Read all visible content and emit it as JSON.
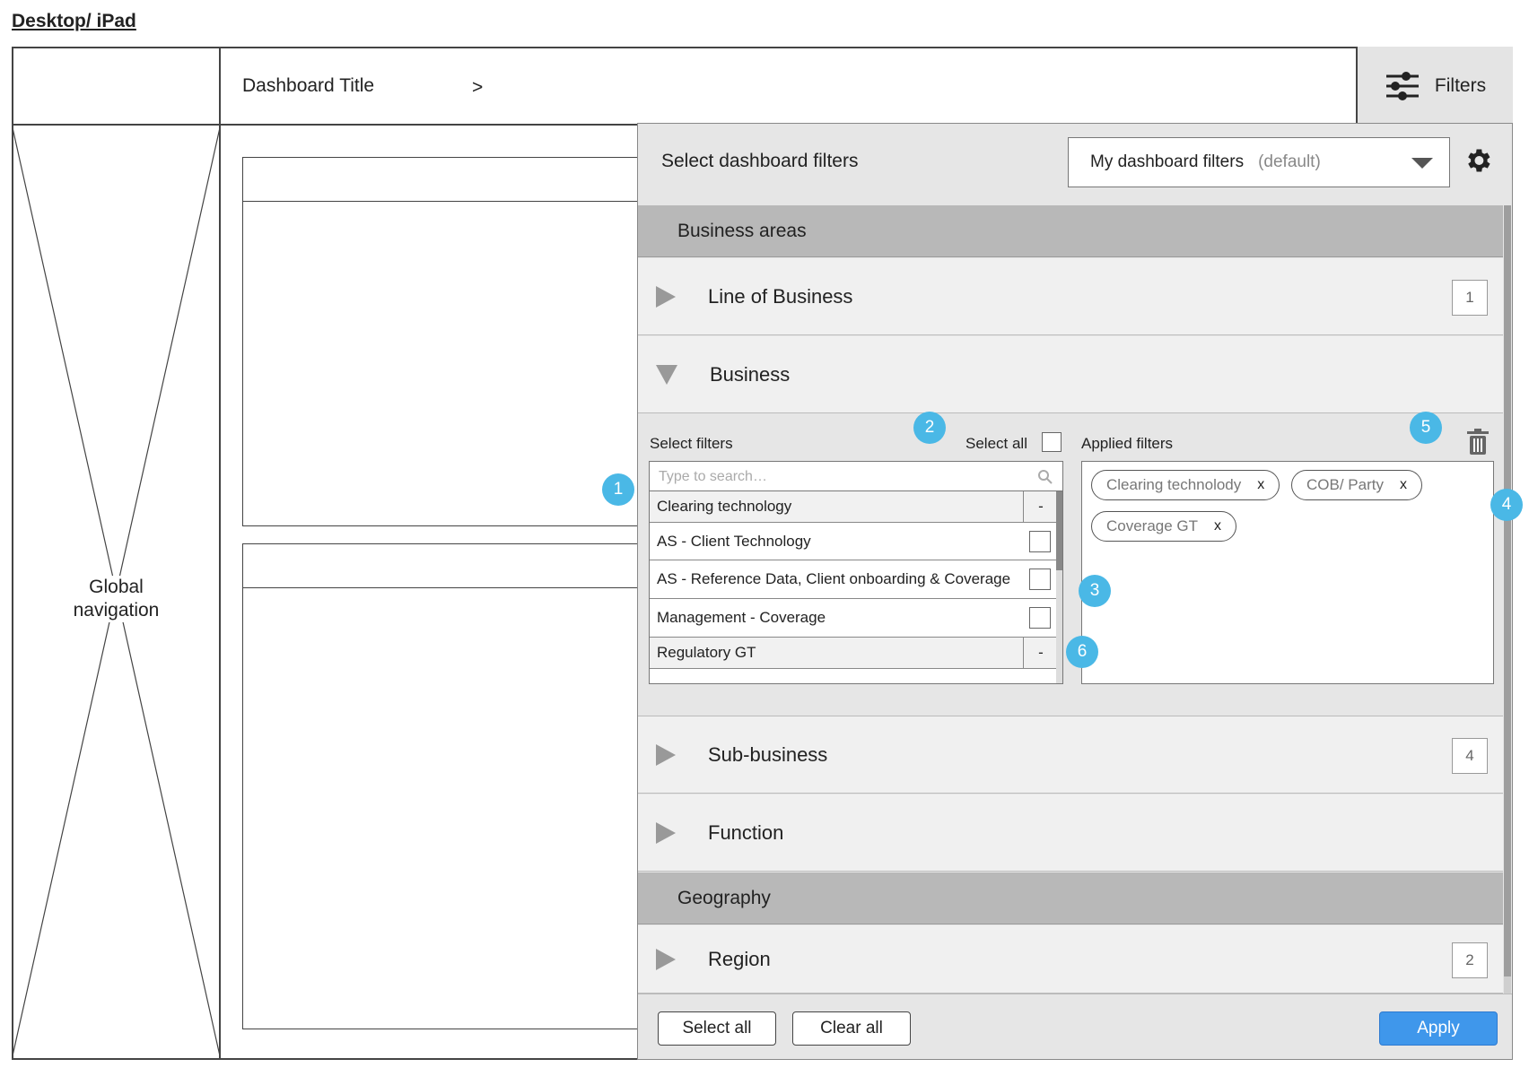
{
  "page_label": "Desktop/ iPad",
  "header": {
    "title": "Dashboard Title",
    "chevron": ">",
    "filters_label": "Filters"
  },
  "nav": {
    "label_line1": "Global",
    "label_line2": "navigation"
  },
  "panel": {
    "title": "Select dashboard filters",
    "preset": {
      "value": "My dashboard filters",
      "note": "(default)"
    },
    "sections": [
      {
        "label": "Business areas"
      },
      {
        "label": "Geography"
      }
    ],
    "rows": [
      {
        "label": "Line of Business",
        "count": "1"
      },
      {
        "label": "Business",
        "count": ""
      },
      {
        "label": "Sub-business",
        "count": "4"
      },
      {
        "label": "Function",
        "count": ""
      },
      {
        "label": "Region",
        "count": "2"
      }
    ],
    "business_expanded": {
      "select_filters_label": "Select filters",
      "select_all_label": "Select all",
      "applied_filters_label": "Applied filters",
      "search_placeholder": "Type to search…",
      "list_items": [
        {
          "label": "Clearing technology",
          "type": "group",
          "control": "-"
        },
        {
          "label": "AS - Client Technology",
          "type": "item"
        },
        {
          "label": "AS - Reference Data, Client onboarding & Coverage",
          "type": "item"
        },
        {
          "label": "Management - Coverage",
          "type": "item"
        },
        {
          "label": "Regulatory GT",
          "type": "group",
          "control": "-"
        }
      ],
      "applied_chips": [
        {
          "label": "Clearing technolody",
          "remove": "x"
        },
        {
          "label": "COB/ Party",
          "remove": "x"
        },
        {
          "label": "Coverage GT",
          "remove": "x"
        }
      ]
    },
    "annotations": [
      "1",
      "2",
      "3",
      "4",
      "5",
      "6"
    ],
    "footer": {
      "select_all": "Select all",
      "clear_all": "Clear all",
      "apply": "Apply"
    }
  },
  "colors": {
    "accent": "#3f97eb",
    "annotation": "#4ab8e6",
    "section_bg": "#b8b8b8",
    "panel_bg": "#e6e6e6"
  }
}
